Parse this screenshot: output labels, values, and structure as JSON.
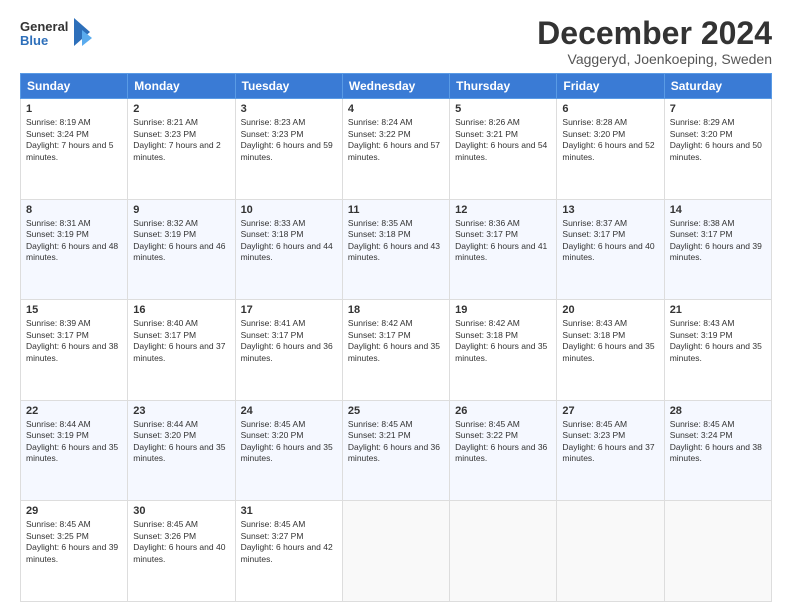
{
  "logo": {
    "general": "General",
    "blue": "Blue"
  },
  "title": "December 2024",
  "location": "Vaggeryd, Joenkoeping, Sweden",
  "headers": [
    "Sunday",
    "Monday",
    "Tuesday",
    "Wednesday",
    "Thursday",
    "Friday",
    "Saturday"
  ],
  "weeks": [
    [
      {
        "day": "1",
        "sunrise": "8:19 AM",
        "sunset": "3:24 PM",
        "daylight": "7 hours and 5 minutes."
      },
      {
        "day": "2",
        "sunrise": "8:21 AM",
        "sunset": "3:23 PM",
        "daylight": "7 hours and 2 minutes."
      },
      {
        "day": "3",
        "sunrise": "8:23 AM",
        "sunset": "3:23 PM",
        "daylight": "6 hours and 59 minutes."
      },
      {
        "day": "4",
        "sunrise": "8:24 AM",
        "sunset": "3:22 PM",
        "daylight": "6 hours and 57 minutes."
      },
      {
        "day": "5",
        "sunrise": "8:26 AM",
        "sunset": "3:21 PM",
        "daylight": "6 hours and 54 minutes."
      },
      {
        "day": "6",
        "sunrise": "8:28 AM",
        "sunset": "3:20 PM",
        "daylight": "6 hours and 52 minutes."
      },
      {
        "day": "7",
        "sunrise": "8:29 AM",
        "sunset": "3:20 PM",
        "daylight": "6 hours and 50 minutes."
      }
    ],
    [
      {
        "day": "8",
        "sunrise": "8:31 AM",
        "sunset": "3:19 PM",
        "daylight": "6 hours and 48 minutes."
      },
      {
        "day": "9",
        "sunrise": "8:32 AM",
        "sunset": "3:19 PM",
        "daylight": "6 hours and 46 minutes."
      },
      {
        "day": "10",
        "sunrise": "8:33 AM",
        "sunset": "3:18 PM",
        "daylight": "6 hours and 44 minutes."
      },
      {
        "day": "11",
        "sunrise": "8:35 AM",
        "sunset": "3:18 PM",
        "daylight": "6 hours and 43 minutes."
      },
      {
        "day": "12",
        "sunrise": "8:36 AM",
        "sunset": "3:17 PM",
        "daylight": "6 hours and 41 minutes."
      },
      {
        "day": "13",
        "sunrise": "8:37 AM",
        "sunset": "3:17 PM",
        "daylight": "6 hours and 40 minutes."
      },
      {
        "day": "14",
        "sunrise": "8:38 AM",
        "sunset": "3:17 PM",
        "daylight": "6 hours and 39 minutes."
      }
    ],
    [
      {
        "day": "15",
        "sunrise": "8:39 AM",
        "sunset": "3:17 PM",
        "daylight": "6 hours and 38 minutes."
      },
      {
        "day": "16",
        "sunrise": "8:40 AM",
        "sunset": "3:17 PM",
        "daylight": "6 hours and 37 minutes."
      },
      {
        "day": "17",
        "sunrise": "8:41 AM",
        "sunset": "3:17 PM",
        "daylight": "6 hours and 36 minutes."
      },
      {
        "day": "18",
        "sunrise": "8:42 AM",
        "sunset": "3:17 PM",
        "daylight": "6 hours and 35 minutes."
      },
      {
        "day": "19",
        "sunrise": "8:42 AM",
        "sunset": "3:18 PM",
        "daylight": "6 hours and 35 minutes."
      },
      {
        "day": "20",
        "sunrise": "8:43 AM",
        "sunset": "3:18 PM",
        "daylight": "6 hours and 35 minutes."
      },
      {
        "day": "21",
        "sunrise": "8:43 AM",
        "sunset": "3:19 PM",
        "daylight": "6 hours and 35 minutes."
      }
    ],
    [
      {
        "day": "22",
        "sunrise": "8:44 AM",
        "sunset": "3:19 PM",
        "daylight": "6 hours and 35 minutes."
      },
      {
        "day": "23",
        "sunrise": "8:44 AM",
        "sunset": "3:20 PM",
        "daylight": "6 hours and 35 minutes."
      },
      {
        "day": "24",
        "sunrise": "8:45 AM",
        "sunset": "3:20 PM",
        "daylight": "6 hours and 35 minutes."
      },
      {
        "day": "25",
        "sunrise": "8:45 AM",
        "sunset": "3:21 PM",
        "daylight": "6 hours and 36 minutes."
      },
      {
        "day": "26",
        "sunrise": "8:45 AM",
        "sunset": "3:22 PM",
        "daylight": "6 hours and 36 minutes."
      },
      {
        "day": "27",
        "sunrise": "8:45 AM",
        "sunset": "3:23 PM",
        "daylight": "6 hours and 37 minutes."
      },
      {
        "day": "28",
        "sunrise": "8:45 AM",
        "sunset": "3:24 PM",
        "daylight": "6 hours and 38 minutes."
      }
    ],
    [
      {
        "day": "29",
        "sunrise": "8:45 AM",
        "sunset": "3:25 PM",
        "daylight": "6 hours and 39 minutes."
      },
      {
        "day": "30",
        "sunrise": "8:45 AM",
        "sunset": "3:26 PM",
        "daylight": "6 hours and 40 minutes."
      },
      {
        "day": "31",
        "sunrise": "8:45 AM",
        "sunset": "3:27 PM",
        "daylight": "6 hours and 42 minutes."
      },
      null,
      null,
      null,
      null
    ]
  ],
  "labels": {
    "sunrise": "Sunrise:",
    "sunset": "Sunset:",
    "daylight": "Daylight:"
  }
}
